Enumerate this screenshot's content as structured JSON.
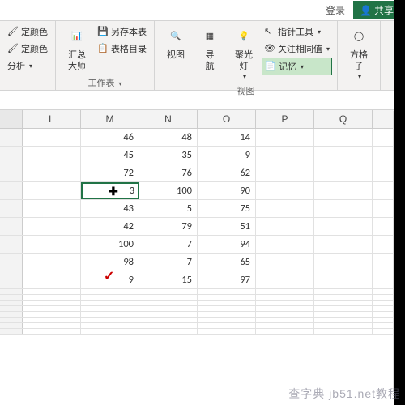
{
  "titlebar": {
    "login": "登录",
    "share": "共享"
  },
  "ribbon": {
    "g1": {
      "items": [
        "定颜色",
        "定颜色",
        "分析"
      ],
      "dd": "▾"
    },
    "g2": {
      "huizong": "汇总\n大师",
      "saveAs": "另存本表",
      "tableToc": "表格目录",
      "label": "工作表",
      "dd": "▾"
    },
    "g3": {
      "view": "视图",
      "nav": "导\n航",
      "spotlight": "聚光\n灯",
      "pointer": "指针工具",
      "sameValue": "关注相同值",
      "memory": "记忆",
      "label": "视图",
      "dd": "▾"
    },
    "g4": {
      "fgz": "方格\n子",
      "dd": "▾"
    }
  },
  "columns": [
    "",
    "L",
    "M",
    "N",
    "O",
    "P",
    "Q"
  ],
  "chart_data": {
    "type": "table",
    "columns": [
      "L",
      "M",
      "N",
      "O",
      "P",
      "Q"
    ],
    "rows": [
      [
        "",
        "46",
        "48",
        "14",
        "",
        ""
      ],
      [
        "",
        "45",
        "35",
        "9",
        "",
        ""
      ],
      [
        "",
        "72",
        "76",
        "62",
        "",
        ""
      ],
      [
        "",
        "3",
        "100",
        "90",
        "",
        ""
      ],
      [
        "",
        "43",
        "5",
        "75",
        "",
        ""
      ],
      [
        "",
        "42",
        "79",
        "51",
        "",
        ""
      ],
      [
        "",
        "100",
        "7",
        "94",
        "",
        ""
      ],
      [
        "",
        "98",
        "7",
        "65",
        "",
        ""
      ],
      [
        "",
        "9",
        "15",
        "97",
        "",
        ""
      ]
    ],
    "selected": {
      "col": "M",
      "rowIndex": 3
    }
  },
  "watermark": "查字典 jb51.net教程"
}
